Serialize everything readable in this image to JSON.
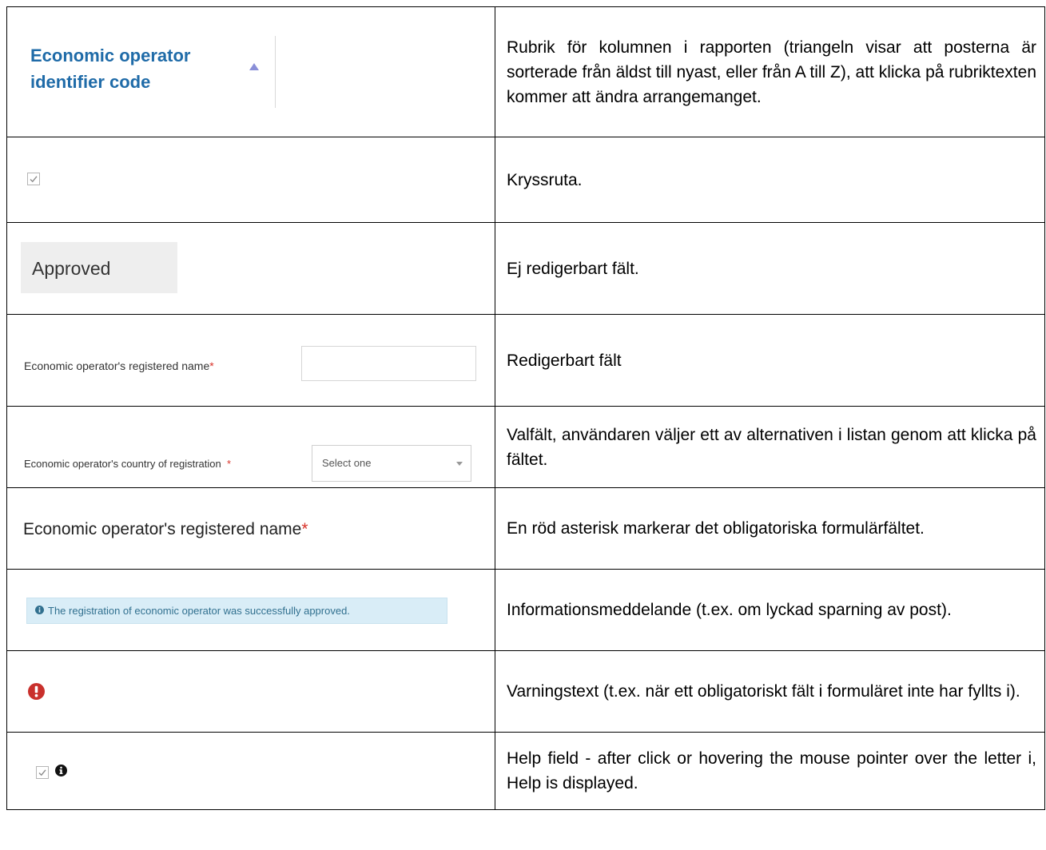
{
  "rows": [
    {
      "example": {
        "header_text": "Economic operator identifier code"
      },
      "description": "Rubrik för kolumnen i rapporten (triangeln visar att posterna är sorterade från äldst till nyast, eller från A till Z), att klicka på rubriktexten kommer att ändra arrangemanget."
    },
    {
      "example": {
        "checked": true
      },
      "description": "Kryssruta."
    },
    {
      "example": {
        "value": "Approved"
      },
      "description": "Ej redigerbart fält."
    },
    {
      "example": {
        "label": "Economic operator's registered name",
        "required_mark": "*",
        "value": ""
      },
      "description": "Redigerbart fält"
    },
    {
      "example": {
        "label": "Economic operator's country of registration",
        "required_mark": "*",
        "selected": "Select one"
      },
      "description": "Valfält, användaren väljer ett av alternativen i listan genom att klicka på fältet."
    },
    {
      "example": {
        "label": "Economic operator's registered name",
        "required_mark": "*"
      },
      "description": "En röd asterisk markerar det obligatoriska formulärfältet."
    },
    {
      "example": {
        "message": "The registration of economic operator was successfully approved."
      },
      "description": "Informationsmeddelande (t.ex. om lyckad sparning av post)."
    },
    {
      "example": {
        "icon": "exclamation-circle-icon"
      },
      "description": "Varningstext (t.ex. när ett obligatoriskt fält i formuläret inte har fyllts i)."
    },
    {
      "example": {
        "checked": true,
        "icon": "info-circle-icon"
      },
      "description": "Help field - after click or hovering the mouse pointer over the letter i, Help is displayed."
    }
  ],
  "colors": {
    "header_link": "#1f6ba8",
    "sort_arrow": "#8a8fd8",
    "required": "#d9342b",
    "readonly_bg": "#eeeeee",
    "info_bg": "#d9edf7",
    "info_text": "#31708f",
    "warning": "#c9302c"
  }
}
